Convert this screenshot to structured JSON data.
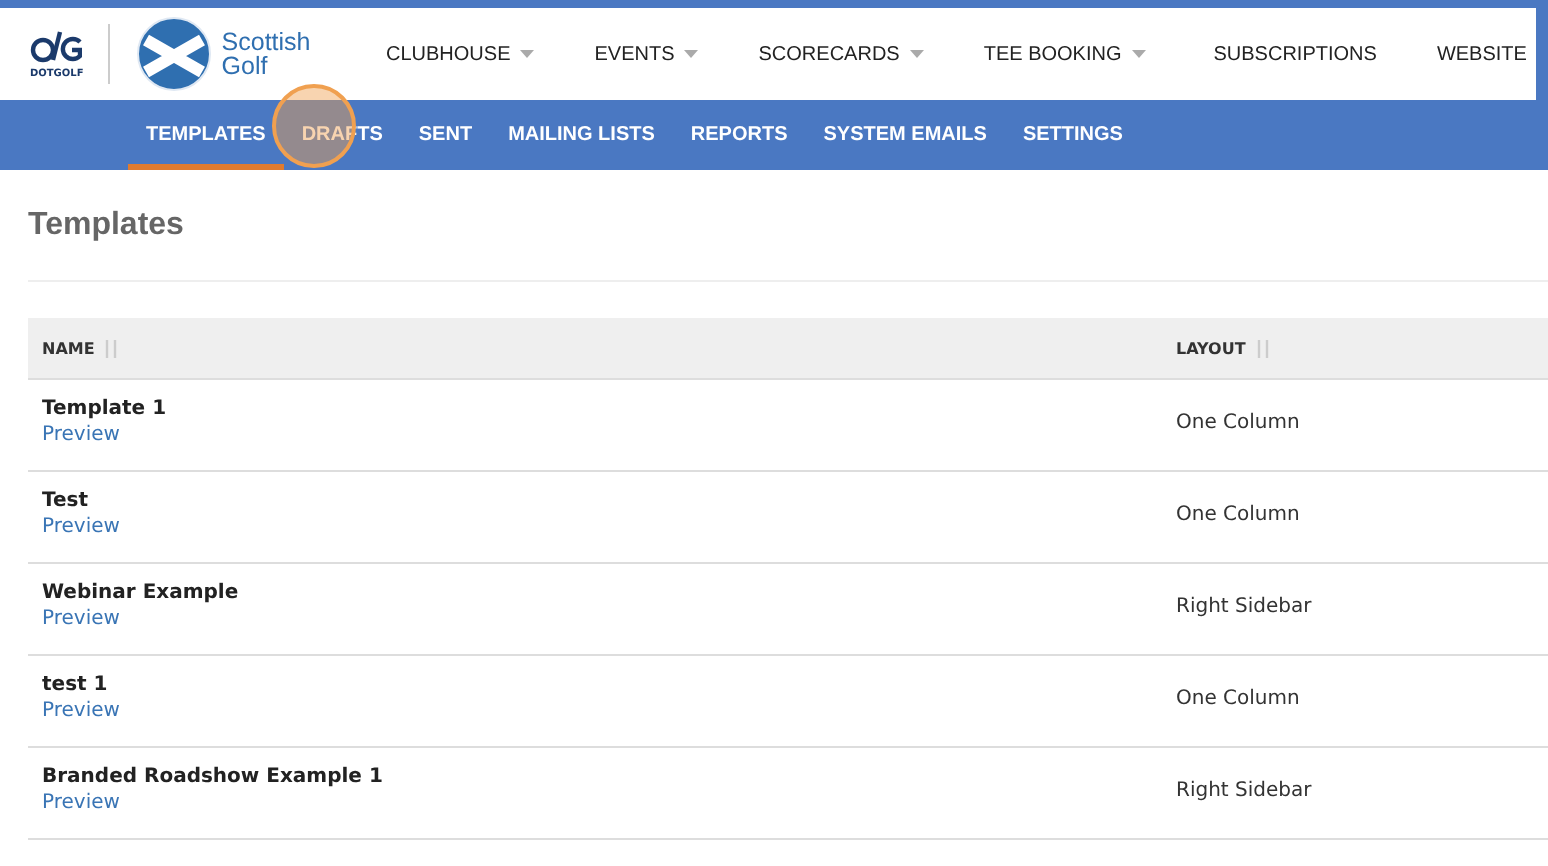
{
  "brand": {
    "dotgolf_label": "DOTGOLF",
    "partner_name_line_1": "Scottish",
    "partner_name_line_2": "Golf"
  },
  "main_nav": [
    {
      "label": "CLUBHOUSE",
      "dropdown": true
    },
    {
      "label": "EVENTS",
      "dropdown": true
    },
    {
      "label": "SCORECARDS",
      "dropdown": true
    },
    {
      "label": "TEE BOOKING",
      "dropdown": true
    },
    {
      "label": "SUBSCRIPTIONS",
      "dropdown": false
    },
    {
      "label": "WEBSITE",
      "dropdown": false
    }
  ],
  "sub_nav": [
    {
      "label": "TEMPLATES",
      "selected": true,
      "click_highlight": false
    },
    {
      "label": "DRAFTS",
      "selected": false,
      "click_highlight": true
    },
    {
      "label": "SENT",
      "selected": false,
      "click_highlight": false
    },
    {
      "label": "MAILING LISTS",
      "selected": false,
      "click_highlight": false
    },
    {
      "label": "REPORTS",
      "selected": false,
      "click_highlight": false
    },
    {
      "label": "SYSTEM EMAILS",
      "selected": false,
      "click_highlight": false
    },
    {
      "label": "SETTINGS",
      "selected": false,
      "click_highlight": false
    }
  ],
  "page_title": "Templates",
  "table": {
    "columns": [
      "NAME",
      "LAYOUT"
    ],
    "rows": [
      {
        "name": "Template 1",
        "link": "Preview",
        "layout": "One Column"
      },
      {
        "name": "Test",
        "link": "Preview",
        "layout": "One Column"
      },
      {
        "name": "Webinar Example",
        "link": "Preview",
        "layout": "Right Sidebar"
      },
      {
        "name": "test 1",
        "link": "Preview",
        "layout": "One Column"
      },
      {
        "name": "Branded Roadshow Example 1",
        "link": "Preview",
        "layout": "Right Sidebar"
      }
    ]
  }
}
